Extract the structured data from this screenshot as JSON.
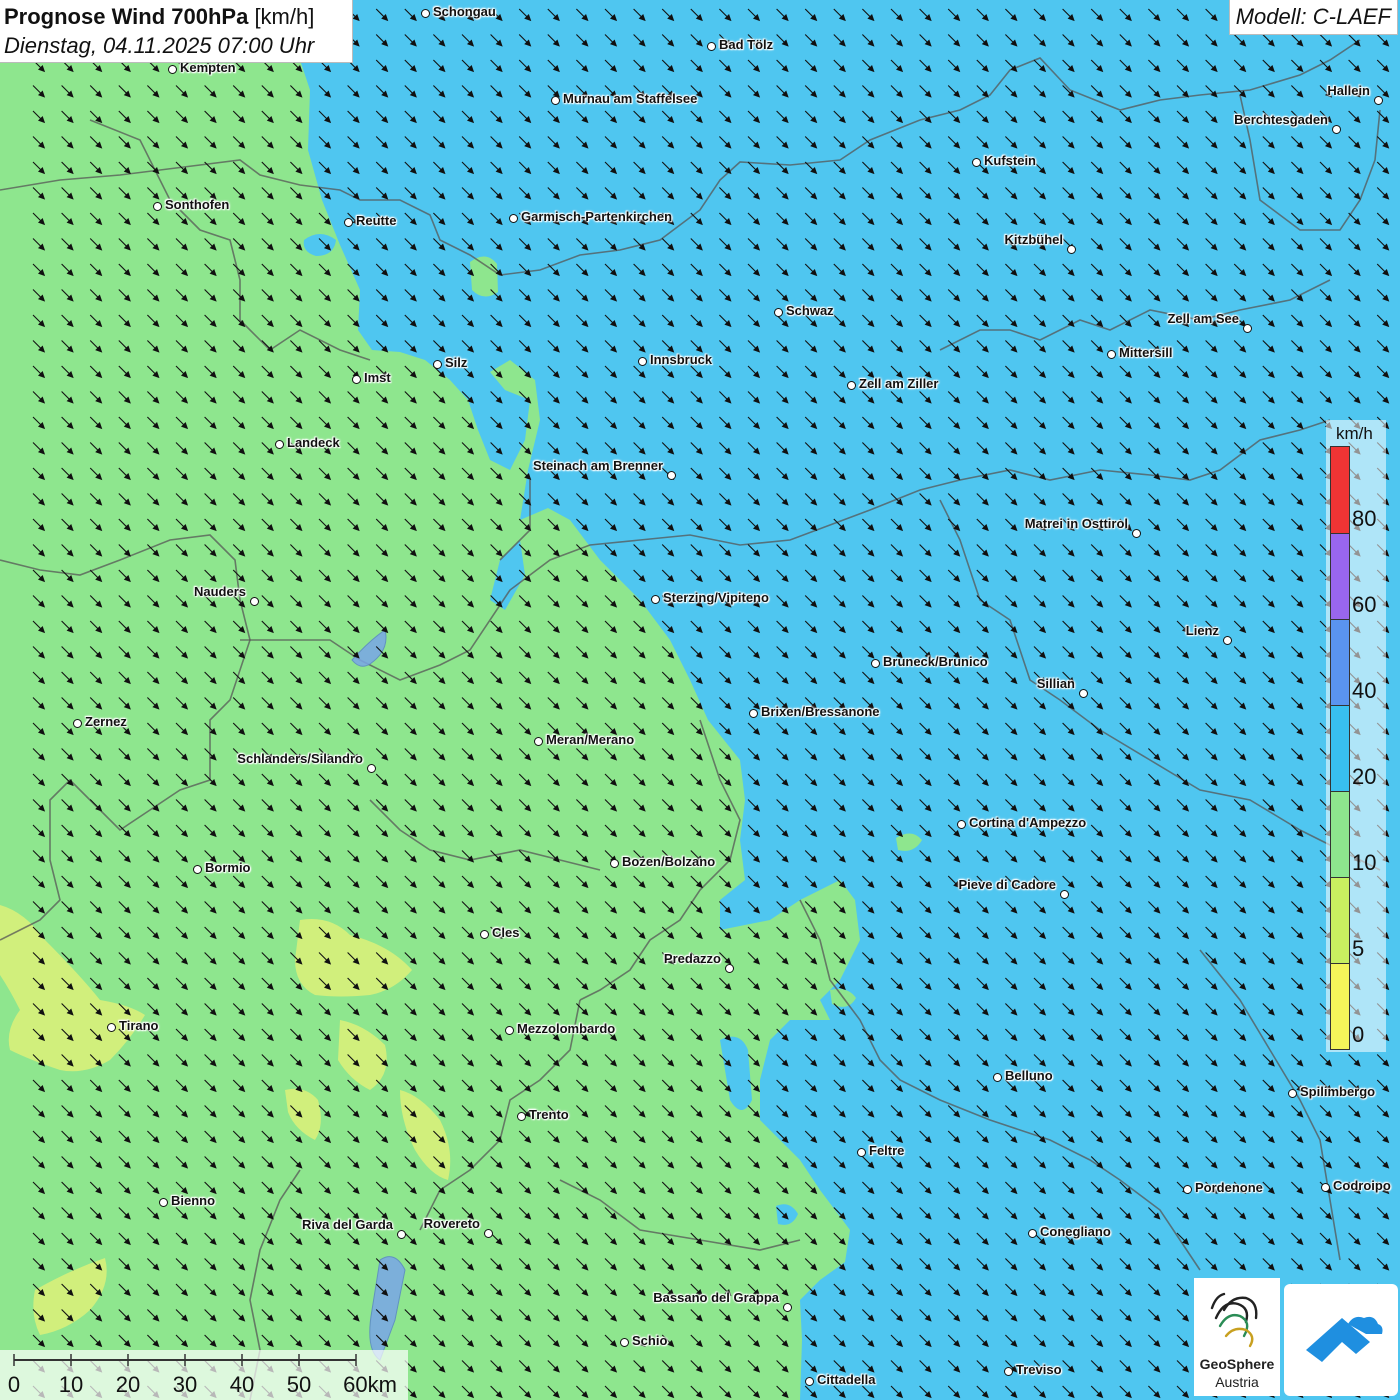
{
  "header": {
    "title_bold": "Prognose Wind 700hPa",
    "title_unit": "[km/h]",
    "datetime": "Dienstag, 04.11.2025 07:00 Uhr",
    "model": "Modell: C-LAEF"
  },
  "legend": {
    "unit": "km/h",
    "classes": [
      {
        "from": 0,
        "to": 5,
        "color": "#f5f55a",
        "label": "0"
      },
      {
        "from": 5,
        "to": 10,
        "color": "#c8f060",
        "label": "5"
      },
      {
        "from": 10,
        "to": 20,
        "color": "#8ee68e",
        "label": "10"
      },
      {
        "from": 20,
        "to": 40,
        "color": "#38bff0",
        "label": "20"
      },
      {
        "from": 40,
        "to": 60,
        "color": "#5a94f0",
        "label": "40"
      },
      {
        "from": 60,
        "to": 80,
        "color": "#9966ee",
        "label": "60"
      },
      {
        "from": 80,
        "to": 100,
        "color": "#f03434",
        "label": "80"
      }
    ]
  },
  "scale_bar": {
    "labels": [
      "0",
      "10",
      "20",
      "30",
      "40",
      "50",
      "60km"
    ]
  },
  "logos": {
    "geosphere_line1": "GeoSphere",
    "geosphere_line2": "Austria"
  },
  "wind": {
    "direction": "from northwest",
    "predominant_speed_class_west": "10-20 km/h",
    "predominant_speed_class_east": "20-40 km/h"
  },
  "cities": [
    {
      "name": "Schongau"
    },
    {
      "name": "Bad Tölz"
    },
    {
      "name": "Kempten"
    },
    {
      "name": "Murnau am Staffelsee"
    },
    {
      "name": "Hallein"
    },
    {
      "name": "Berchtesgaden"
    },
    {
      "name": "Kufstein"
    },
    {
      "name": "Sonthofen"
    },
    {
      "name": "Reutte"
    },
    {
      "name": "Garmisch-Partenkirchen"
    },
    {
      "name": "Kitzbühel"
    },
    {
      "name": "Schwaz"
    },
    {
      "name": "Zell am See"
    },
    {
      "name": "Mittersill"
    },
    {
      "name": "Silz"
    },
    {
      "name": "Innsbruck"
    },
    {
      "name": "Imst"
    },
    {
      "name": "Zell am Ziller"
    },
    {
      "name": "Landeck"
    },
    {
      "name": "Steinach am Brenner"
    },
    {
      "name": "Matrei in Osttirol"
    },
    {
      "name": "Nauders"
    },
    {
      "name": "Sterzing/Vipiteno"
    },
    {
      "name": "Lienz"
    },
    {
      "name": "Bruneck/Brunico"
    },
    {
      "name": "Sillian"
    },
    {
      "name": "Brixen/Bressanone"
    },
    {
      "name": "Zernez"
    },
    {
      "name": "Meran/Merano"
    },
    {
      "name": "Schlanders/Silandro"
    },
    {
      "name": "Cortina d'Ampezzo"
    },
    {
      "name": "Bozen/Bolzano"
    },
    {
      "name": "Bormio"
    },
    {
      "name": "Pieve di Cadore"
    },
    {
      "name": "Cles"
    },
    {
      "name": "Predazzo"
    },
    {
      "name": "Tirano"
    },
    {
      "name": "Mezzolombardo"
    },
    {
      "name": "Belluno"
    },
    {
      "name": "Spilimbergo"
    },
    {
      "name": "Trento"
    },
    {
      "name": "Feltre"
    },
    {
      "name": "Pordenone"
    },
    {
      "name": "Codroipo"
    },
    {
      "name": "Bienno"
    },
    {
      "name": "Riva del Garda"
    },
    {
      "name": "Rovereto"
    },
    {
      "name": "Conegliano"
    },
    {
      "name": "Bassano del Grappa"
    },
    {
      "name": "Schio"
    },
    {
      "name": "Treviso"
    },
    {
      "name": "Cittadella"
    }
  ]
}
